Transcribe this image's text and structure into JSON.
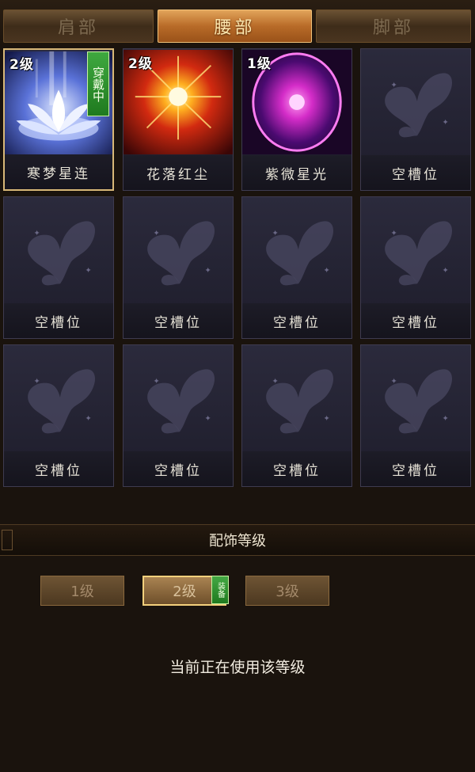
{
  "tabs": [
    {
      "label": "肩部",
      "active": false
    },
    {
      "label": "腰部",
      "active": true
    },
    {
      "label": "脚部",
      "active": false
    }
  ],
  "slots": [
    {
      "name": "寒梦星连",
      "level": "2级",
      "equipped": true,
      "equipped_label": "穿戴中",
      "art": "lotus",
      "selected": true
    },
    {
      "name": "花落红尘",
      "level": "2级",
      "art": "sunburst"
    },
    {
      "name": "紫微星光",
      "level": "1级",
      "art": "purple-orb"
    },
    {
      "name": "空槽位",
      "art": "empty"
    },
    {
      "name": "空槽位",
      "art": "empty"
    },
    {
      "name": "空槽位",
      "art": "empty"
    },
    {
      "name": "空槽位",
      "art": "empty"
    },
    {
      "name": "空槽位",
      "art": "empty"
    },
    {
      "name": "空槽位",
      "art": "empty"
    },
    {
      "name": "空槽位",
      "art": "empty"
    },
    {
      "name": "空槽位",
      "art": "empty"
    },
    {
      "name": "空槽位",
      "art": "empty"
    }
  ],
  "level_section": {
    "title": "配饰等级",
    "buttons": [
      {
        "label": "1级",
        "active": false
      },
      {
        "label": "2级",
        "active": true
      },
      {
        "label": "3级",
        "active": false
      }
    ],
    "equipped_tag": "装备",
    "status": "当前正在使用该等级"
  },
  "colors": {
    "accent_gold": "#f4d07c",
    "equipped_green": "#2f9a2f",
    "active_tab": "#c47a32"
  }
}
